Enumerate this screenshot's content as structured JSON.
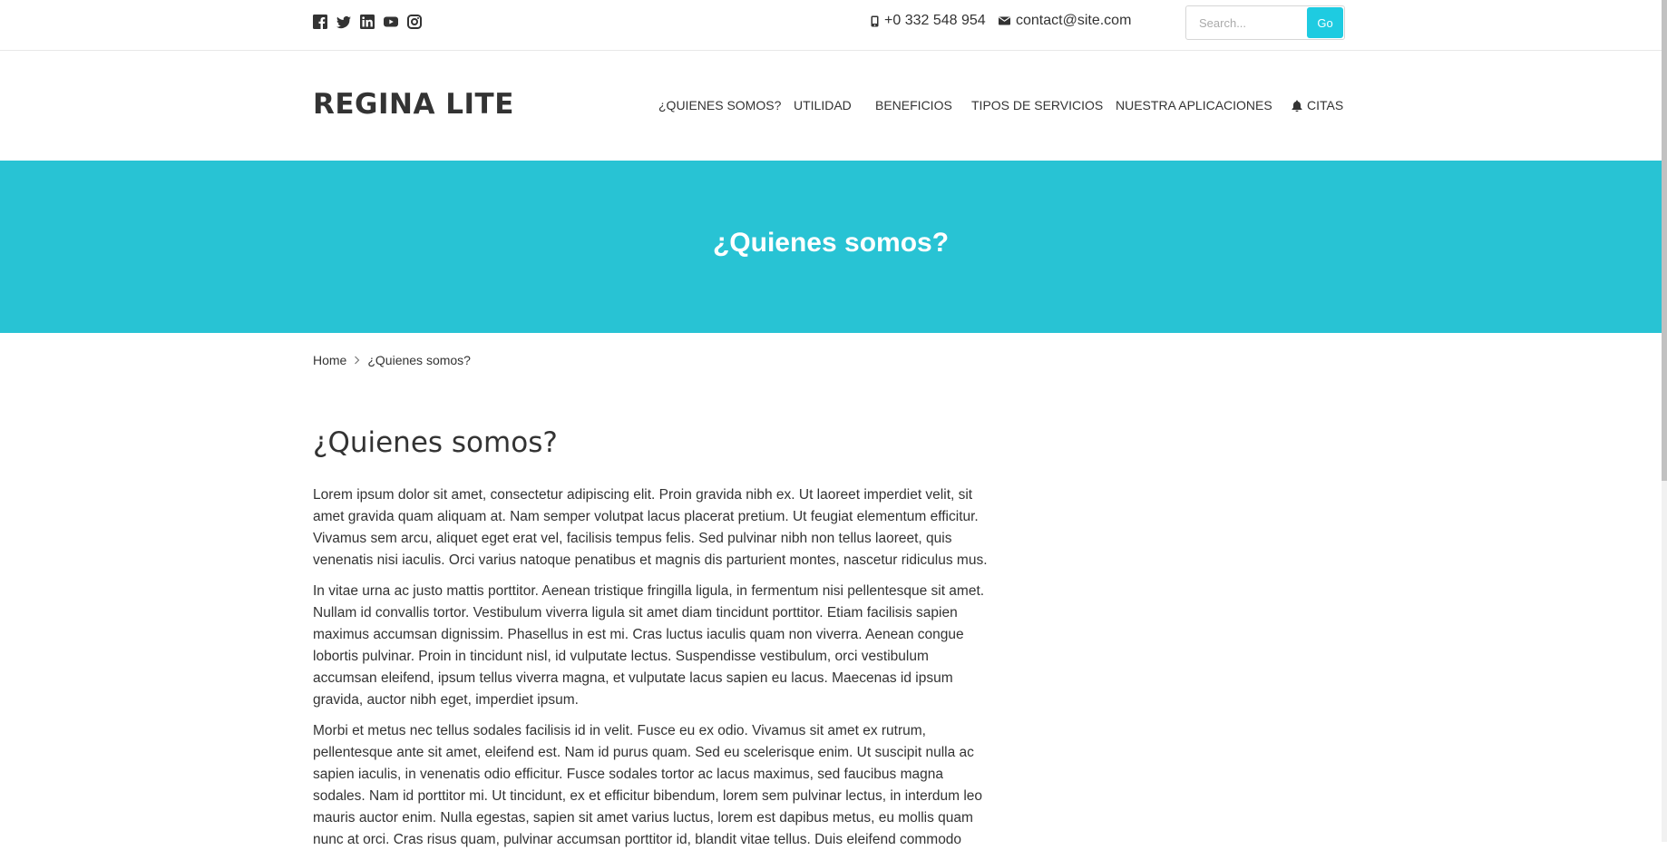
{
  "topbar": {
    "social": [
      {
        "icon": "facebook-icon"
      },
      {
        "icon": "twitter-icon"
      },
      {
        "icon": "linkedin-icon"
      },
      {
        "icon": "youtube-icon"
      },
      {
        "icon": "instagram-icon"
      }
    ],
    "phone": "+0 332 548 954",
    "email": "contact@site.com",
    "search": {
      "placeholder": "Search...",
      "button": "Go"
    }
  },
  "header": {
    "logo": "REGINA LITE",
    "nav": [
      {
        "label": "¿QUIENES SOMOS?"
      },
      {
        "label": "UTILIDAD"
      },
      {
        "label": "BENEFICIOS"
      },
      {
        "label": "TIPOS DE SERVICIOS"
      },
      {
        "label": "NUESTRA APLICACIONES"
      },
      {
        "label": "CITAS",
        "icon": "bell-icon"
      }
    ]
  },
  "hero": {
    "title": "¿Quienes somos?"
  },
  "breadcrumb": {
    "home": "Home",
    "current": "¿Quienes somos?"
  },
  "content": {
    "heading": "¿Quienes somos?",
    "paragraphs": [
      "Lorem ipsum dolor sit amet, consectetur adipiscing elit. Proin gravida nibh ex. Ut laoreet imperdiet velit, sit amet gravida quam aliquam at. Nam semper volutpat lacus placerat pretium. Ut feugiat elementum efficitur. Vivamus sem arcu, aliquet eget erat vel, facilisis tempus felis. Sed pulvinar nibh non tellus laoreet, quis venenatis nisi iaculis. Orci varius natoque penatibus et magnis dis parturient montes, nascetur ridiculus mus.",
      "In vitae urna ac justo mattis porttitor. Aenean tristique fringilla ligula, in fermentum nisi pellentesque sit amet. Nullam id convallis tortor. Vestibulum viverra ligula sit amet diam tincidunt porttitor. Etiam facilisis sapien maximus accumsan dignissim. Phasellus in est mi. Cras luctus iaculis quam non viverra. Aenean congue lobortis pulvinar. Proin in tincidunt nisl, id vulputate lectus. Suspendisse vestibulum, orci vestibulum accumsan eleifend, ipsum tellus viverra magna, et vulputate lacus sapien eu lacus. Maecenas id ipsum gravida, auctor nibh eget, imperdiet ipsum.",
      "Morbi et metus nec tellus sodales facilisis id in velit. Fusce eu ex odio. Vivamus sit amet ex rutrum, pellentesque ante sit amet, eleifend est. Nam id purus quam. Sed eu scelerisque enim. Ut suscipit nulla ac sapien iaculis, in venenatis odio efficitur. Fusce sodales tortor ac lacus maximus, sed faucibus magna sodales. Nam id porttitor mi. Ut tincidunt, ex et efficitur bibendum, lorem sem pulvinar lectus, in interdum leo mauris auctor enim. Nulla egestas, sapien sit amet varius luctus, lorem est dapibus metus, eu mollis quam nunc at orci. Cras risus quam, pulvinar accumsan porttitor id, blandit vitae tellus. Duis eleifend commodo"
    ]
  },
  "colors": {
    "accent": "#28c3d4",
    "go_button": "#1ecbe1",
    "text": "#333333"
  }
}
